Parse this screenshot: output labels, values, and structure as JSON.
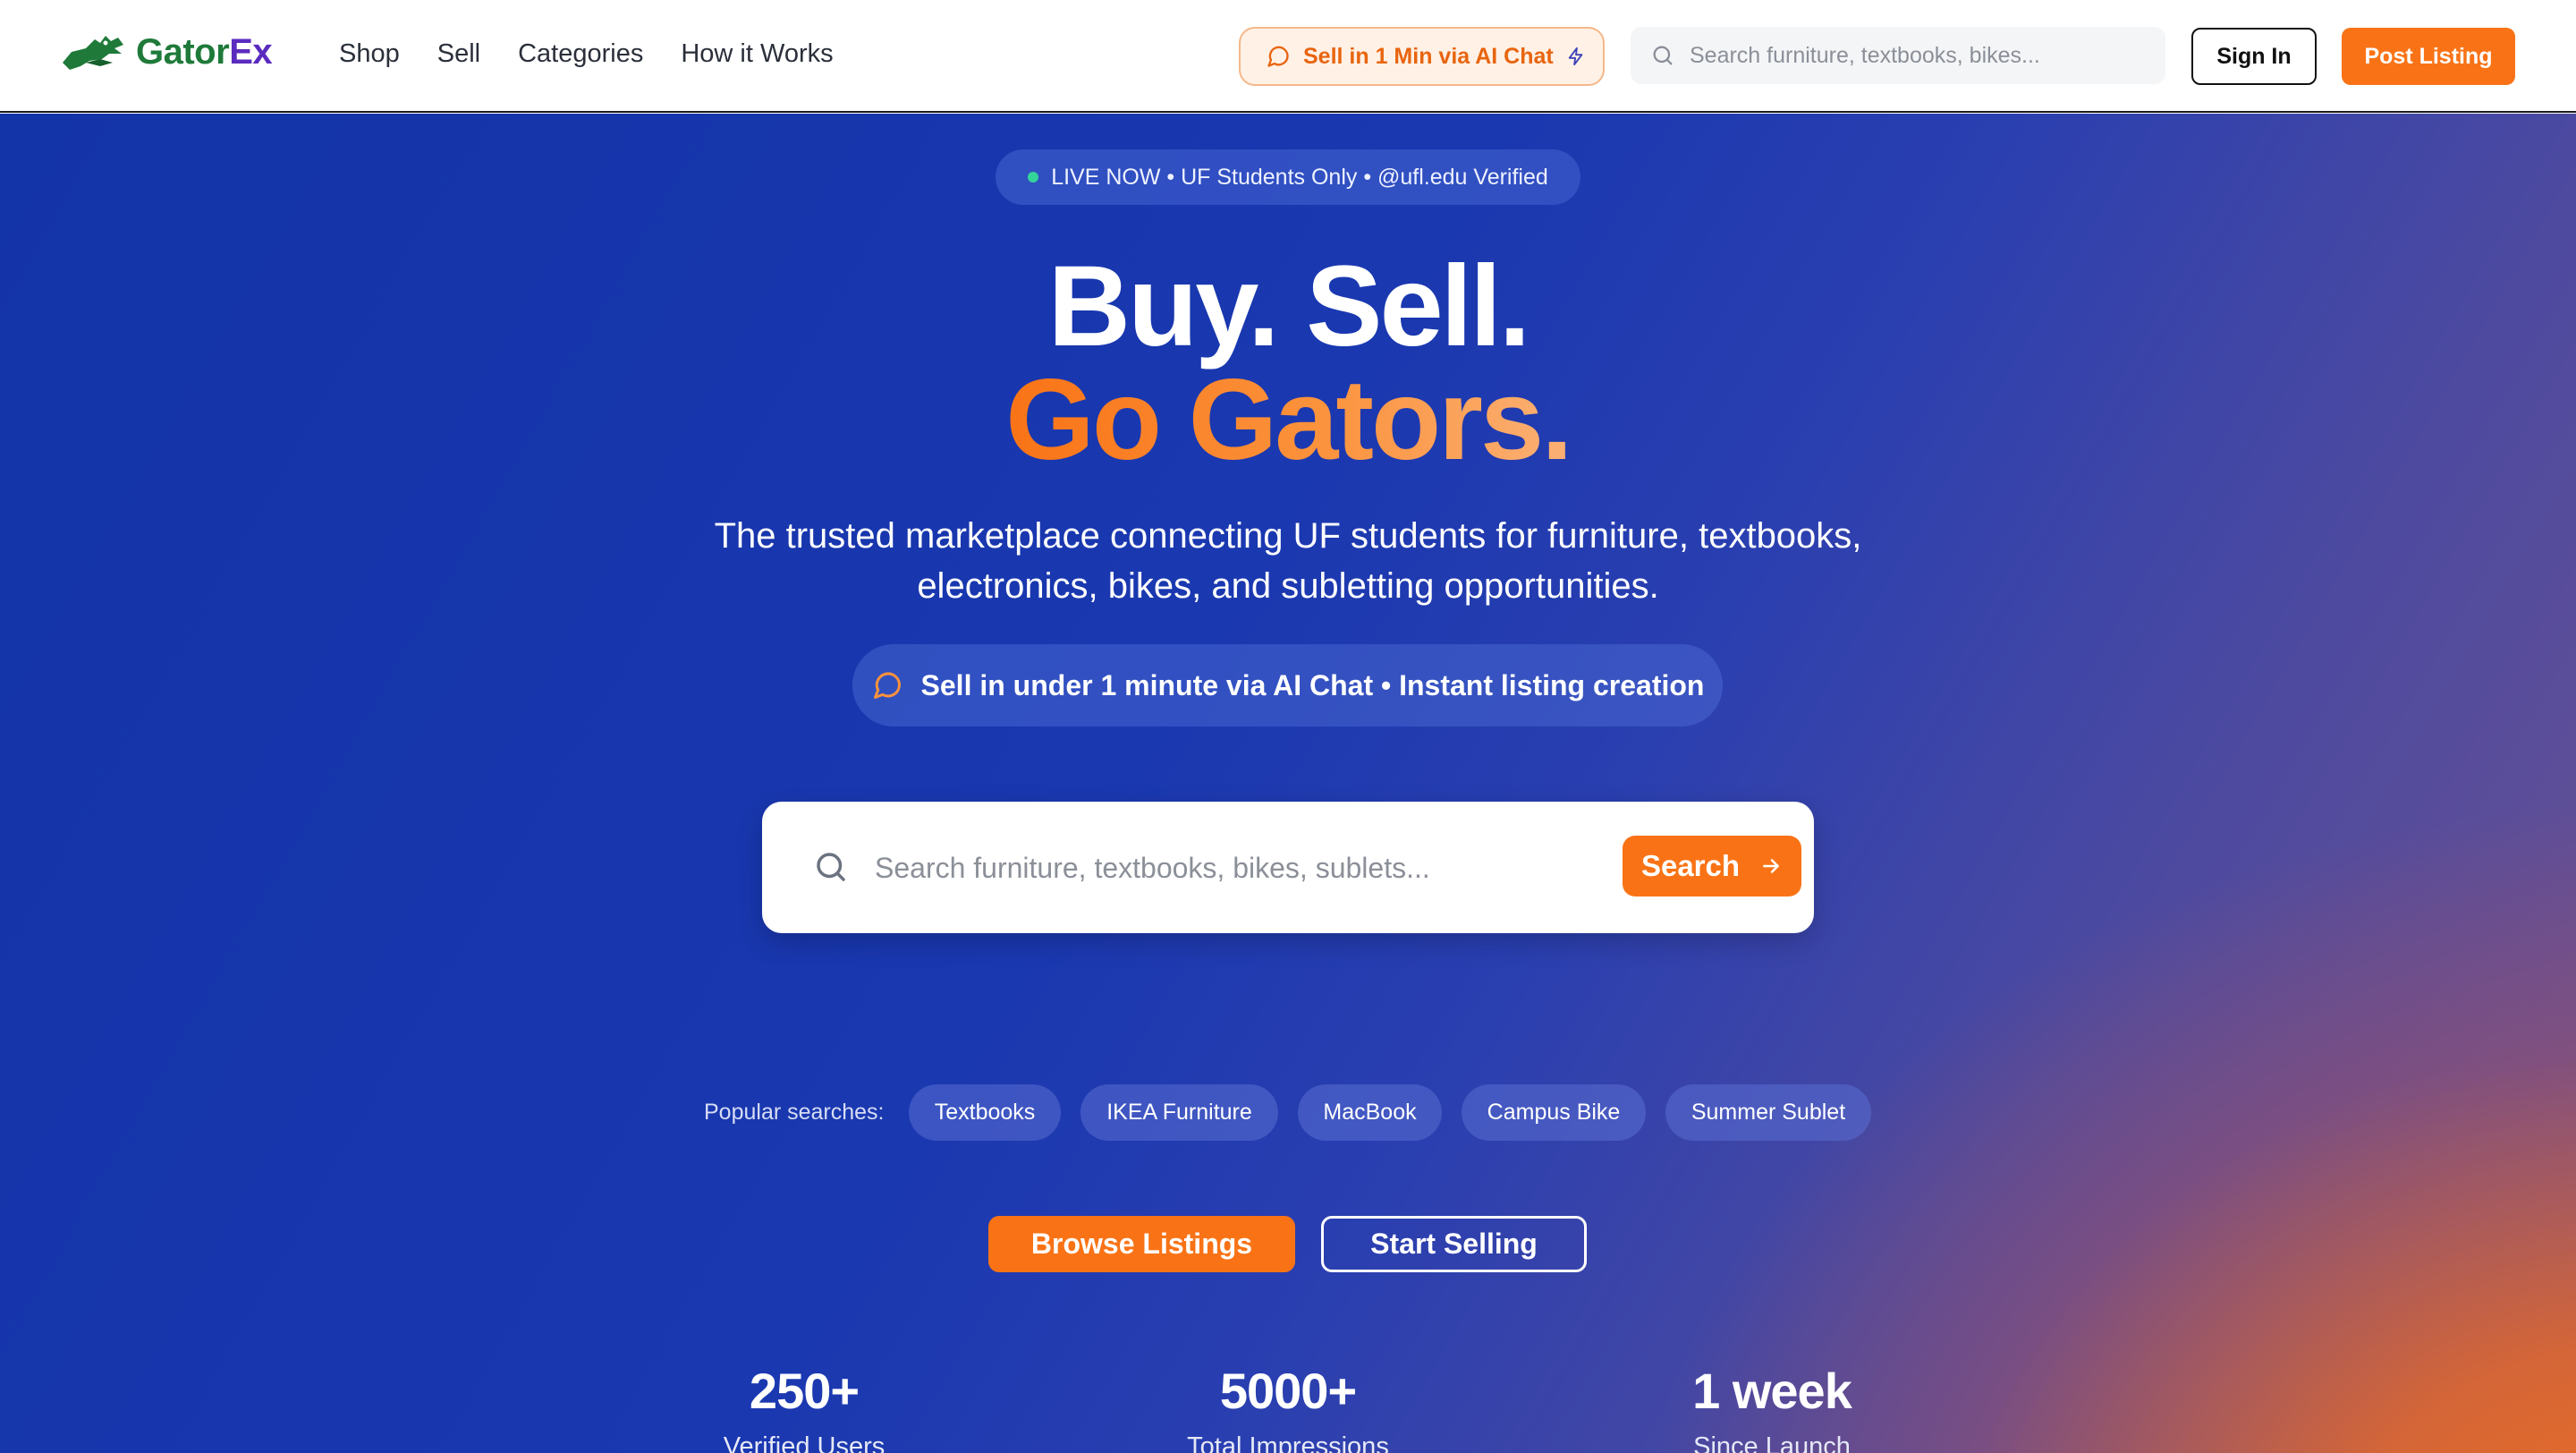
{
  "nav": {
    "logo_part1": "Gator",
    "logo_part2": "Ex",
    "links": [
      "Shop",
      "Sell",
      "Categories",
      "How it Works"
    ],
    "ai_chip_label": "Sell in 1 Min via AI Chat",
    "search_placeholder": "Search furniture, textbooks, bikes...",
    "sign_in_label": "Sign In",
    "post_listing_label": "Post Listing"
  },
  "hero": {
    "live_text": "LIVE NOW • UF Students Only • @ufl.edu Verified",
    "headline_1": "Buy. Sell.",
    "headline_2": "Go Gators.",
    "subtitle_1": "The trusted marketplace connecting UF students for furniture, textbooks,",
    "subtitle_2": "electronics, bikes, and subletting opportunities.",
    "ai_pill_text": "Sell in under 1 minute via AI Chat • Instant listing creation",
    "search_placeholder": "Search furniture, textbooks, bikes, sublets...",
    "search_button_label": "Search",
    "popular_label": "Popular searches:",
    "popular_chips": [
      "Textbooks",
      "IKEA Furniture",
      "MacBook",
      "Campus Bike",
      "Summer Sublet"
    ],
    "browse_label": "Browse Listings",
    "start_selling_label": "Start Selling"
  },
  "stats": [
    {
      "value": "250+",
      "label": "Verified Users"
    },
    {
      "value": "5000+",
      "label": "Total Impressions"
    },
    {
      "value": "1 week",
      "label": "Since Launch"
    }
  ],
  "colors": {
    "accent_orange": "#f97316",
    "brand_green": "#1f7a3a",
    "brand_purple": "#5b2bbf",
    "hero_blue": "#1333a8",
    "live_dot": "#34d399"
  },
  "icons": [
    "gator-logo-icon",
    "chat-bubble-icon",
    "lightning-icon",
    "search-icon",
    "arrow-right-icon"
  ]
}
